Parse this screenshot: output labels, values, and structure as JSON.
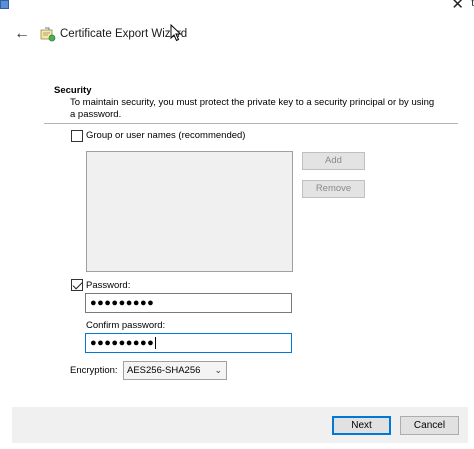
{
  "window": {
    "close_glyph": "✕",
    "edge_char": "t"
  },
  "header": {
    "back_label": "←",
    "title": "Certificate Export Wizard"
  },
  "security": {
    "title": "Security",
    "description": "To maintain security, you must protect the private key to a security principal or by using a password."
  },
  "group_option": {
    "label": "Group or user names (recommended)",
    "checked": false
  },
  "group_buttons": {
    "add": "Add",
    "remove": "Remove"
  },
  "password": {
    "label": "Password:",
    "checked": true,
    "value": "●●●●●●●●●"
  },
  "confirm_password": {
    "label": "Confirm password:",
    "value": "●●●●●●●●●"
  },
  "encryption": {
    "label": "Encryption:",
    "selected": "AES256-SHA256"
  },
  "footer": {
    "next": "Next",
    "cancel": "Cancel"
  },
  "colors": {
    "accent": "#0078d7",
    "footer_bg": "#f0f0f0",
    "disabled_text": "#8a8a8a"
  }
}
